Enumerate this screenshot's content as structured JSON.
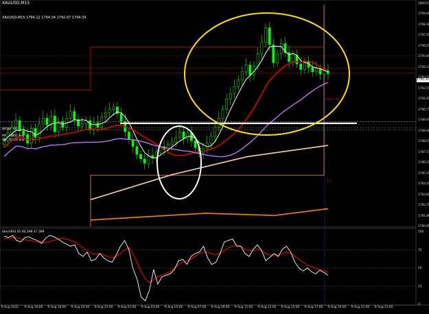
{
  "window_title": "XAUUSD,M15",
  "ohlc_text": "XAUUSD,M15  1794.12 1794.34 1792.07 1794.34",
  "levels_labels": [
    "94186895 sl",
    "94186895 buy 25.00",
    "94126120 buy 25.00"
  ],
  "indicator_label": "StochRSI 25 40.298 47.289",
  "price_axis": [
    "1800.55",
    "1799.40",
    "1798.30",
    "1797.45",
    "1796.65",
    "1795.60",
    "1794.34",
    "1793.55",
    "1792.55",
    "1791.65",
    "1790.75",
    "1789.95",
    "1789.00",
    "1788.05",
    "1787.15",
    "1786.25",
    "1785.35",
    "1784.45",
    "1783.60",
    "1782.70",
    "1781.80",
    "1780.85"
  ],
  "current_price": "1794.34",
  "ind_axis": [
    "100",
    "75",
    "50",
    "25",
    "0"
  ],
  "time_axis": [
    "9 Aug 2022",
    "9 Aug 16:00",
    "9 Aug 18:00",
    "9 Aug 20:00",
    "9 Aug 22:00",
    "9 Aug 01:00",
    "9 Aug 03:00",
    "9 Aug 05:00",
    "9 Aug 07:00",
    "9 Aug 09:00",
    "9 Aug 11:00",
    "9 Aug 13:00",
    "9 Aug 15:00",
    "9 Aug 17:00",
    "9 Aug 19:00",
    "9 Aug 21:00",
    "9 Aug 23:00"
  ],
  "pivot_label": "Pivot R1",
  "s1_label": "S 1",
  "colors": {
    "bull": "#00ff00",
    "bear": "#00ff00",
    "ma_white": "#ffffff",
    "ma_red": "#e00000",
    "ma_violet": "#c070ff",
    "ma_peach": "#ffd0b0",
    "ma_orange": "#ff8000",
    "highlight_yellow": "#ffe000",
    "grid": "#1c1c1c"
  },
  "chart_data": {
    "type": "candlestick",
    "price_range": [
      1780.85,
      1800.55
    ],
    "closes": [
      1788.4,
      1789.1,
      1789.6,
      1790.2,
      1789.3,
      1788.9,
      1788.2,
      1789.5,
      1788.7,
      1789.9,
      1790.4,
      1789.8,
      1790.6,
      1789.2,
      1790.1,
      1789.6,
      1790.4,
      1791.0,
      1790.3,
      1789.7,
      1789.9,
      1790.2,
      1789.4,
      1790.0,
      1789.6,
      1790.5,
      1790.9,
      1791.2,
      1791.4,
      1790.8,
      1790.1,
      1789.2,
      1788.5,
      1787.9,
      1787.2,
      1786.8,
      1786.4,
      1787.1,
      1786.9,
      1787.4,
      1787.9,
      1787.6,
      1788.1,
      1788.3,
      1788.7,
      1789.2,
      1788.6,
      1789.1,
      1788.4,
      1787.8,
      1787.3,
      1787.7,
      1788.2,
      1788.8,
      1789.6,
      1790.4,
      1791.2,
      1792.1,
      1792.6,
      1793.2,
      1793.8,
      1794.5,
      1795.1,
      1794.2,
      1795.0,
      1796.1,
      1797.1,
      1798.4,
      1796.9,
      1795.3,
      1796.1,
      1797.0,
      1796.2,
      1795.4,
      1796.0,
      1795.2,
      1794.7,
      1795.4,
      1794.9,
      1794.5,
      1794.8,
      1794.3,
      1794.6,
      1794.34
    ],
    "stochrsi_line": [
      94,
      92,
      95,
      88,
      86,
      92,
      93,
      90,
      88,
      84,
      91,
      95,
      93,
      90,
      86,
      83,
      80,
      82,
      70,
      66,
      72,
      60,
      62,
      70,
      64,
      60,
      58,
      68,
      80,
      88,
      76,
      50,
      35,
      10,
      5,
      20,
      48,
      28,
      38,
      40,
      42,
      48,
      60,
      62,
      55,
      66,
      70,
      72,
      80,
      64,
      55,
      58,
      70,
      86,
      88,
      90,
      80,
      80,
      70,
      66,
      76,
      82,
      74,
      60,
      65,
      70,
      66,
      76,
      80,
      72,
      58,
      50,
      46,
      50,
      45,
      42,
      47,
      44,
      40
    ],
    "signal_line": [
      90,
      91,
      92,
      92,
      90,
      89,
      88,
      87,
      86,
      86,
      85,
      86,
      88,
      90,
      91,
      90,
      88,
      86,
      82,
      78,
      74,
      70,
      69,
      70,
      68,
      66,
      64,
      66,
      70,
      75,
      78,
      70,
      58,
      45,
      35,
      30,
      34,
      38,
      40,
      42,
      45,
      50,
      55,
      58,
      60,
      62,
      66,
      70,
      72,
      72,
      70,
      68,
      70,
      74,
      78,
      80,
      82,
      80,
      76,
      74,
      74,
      76,
      74,
      70,
      68,
      68,
      68,
      70,
      72,
      70,
      66,
      62,
      58,
      54,
      52,
      50,
      48,
      46,
      44
    ]
  }
}
